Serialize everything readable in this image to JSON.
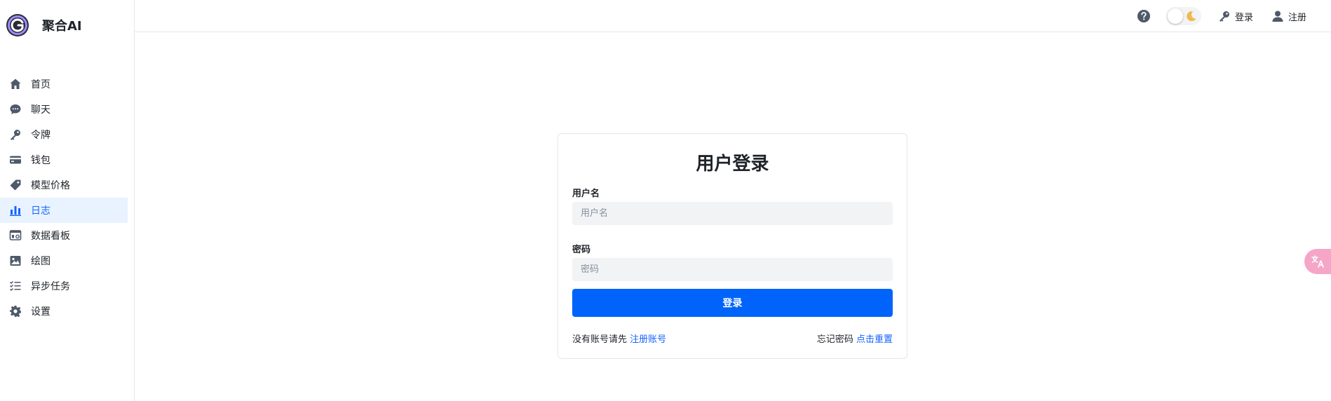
{
  "brand": {
    "name": "聚合AI"
  },
  "sidebar": {
    "items": [
      {
        "label": "首页",
        "icon": "home-icon"
      },
      {
        "label": "聊天",
        "icon": "chat-icon"
      },
      {
        "label": "令牌",
        "icon": "key-icon"
      },
      {
        "label": "钱包",
        "icon": "wallet-icon"
      },
      {
        "label": "模型价格",
        "icon": "tag-icon"
      },
      {
        "label": "日志",
        "icon": "bar-chart-icon",
        "active": true
      },
      {
        "label": "数据看板",
        "icon": "dashboard-icon"
      },
      {
        "label": "绘图",
        "icon": "image-icon"
      },
      {
        "label": "异步任务",
        "icon": "task-list-icon"
      },
      {
        "label": "设置",
        "icon": "gear-icon"
      }
    ]
  },
  "header": {
    "login_label": "登录",
    "register_label": "注册"
  },
  "login": {
    "title": "用户登录",
    "username_label": "用户名",
    "username_placeholder": "用户名",
    "password_label": "密码",
    "password_placeholder": "密码",
    "submit_label": "登录",
    "no_account_text": "没有账号请先",
    "register_link": "注册账号",
    "forgot_text": "忘记密码",
    "reset_link": "点击重置"
  },
  "colors": {
    "accent": "#1664ff",
    "button": "#0064fa",
    "active_bg": "#e8f3ff"
  }
}
